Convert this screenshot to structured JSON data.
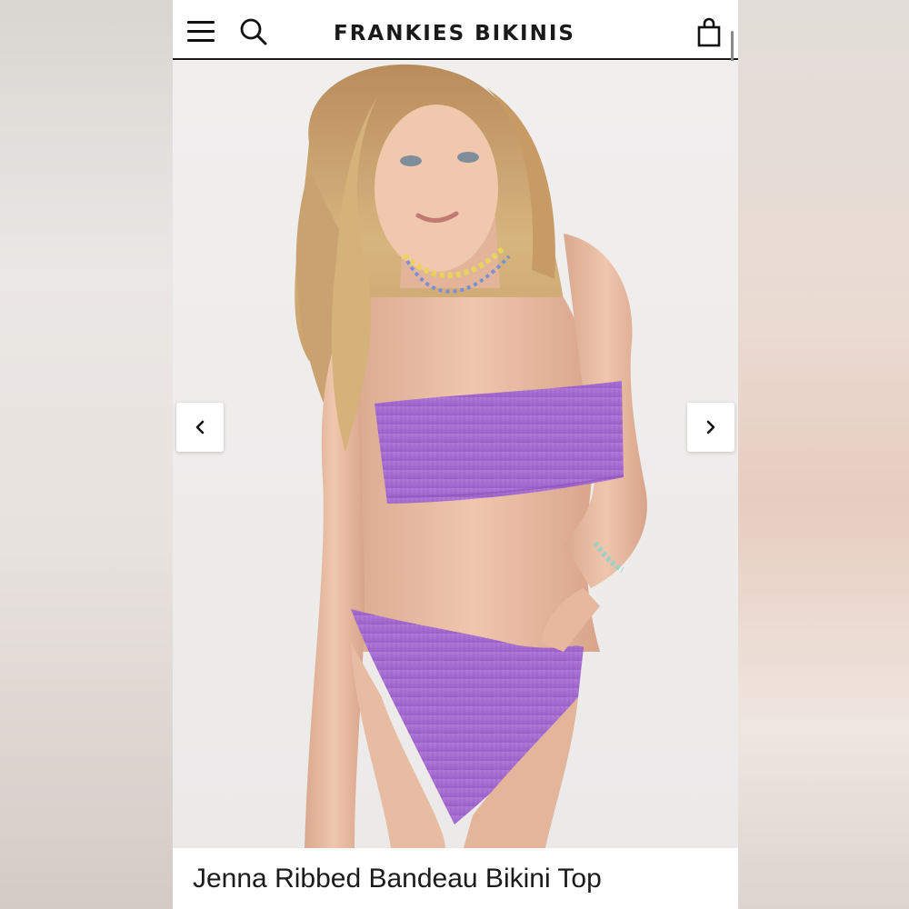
{
  "header": {
    "brand": "FRANKIES BIKINIS",
    "menu_icon": "hamburger-menu-icon",
    "search_icon": "search-icon",
    "bag_icon": "shopping-bag-icon"
  },
  "gallery": {
    "prev_icon": "chevron-left-icon",
    "next_icon": "chevron-right-icon",
    "image_alt": "Model wearing lilac ribbed bandeau bikini"
  },
  "product": {
    "title": "Jenna Ribbed Bandeau Bikini Top"
  },
  "colors": {
    "header_bg": "#ffffff",
    "header_border": "#1a1a1a",
    "bikini": "#a86fd2",
    "text": "#1b1b1b"
  }
}
